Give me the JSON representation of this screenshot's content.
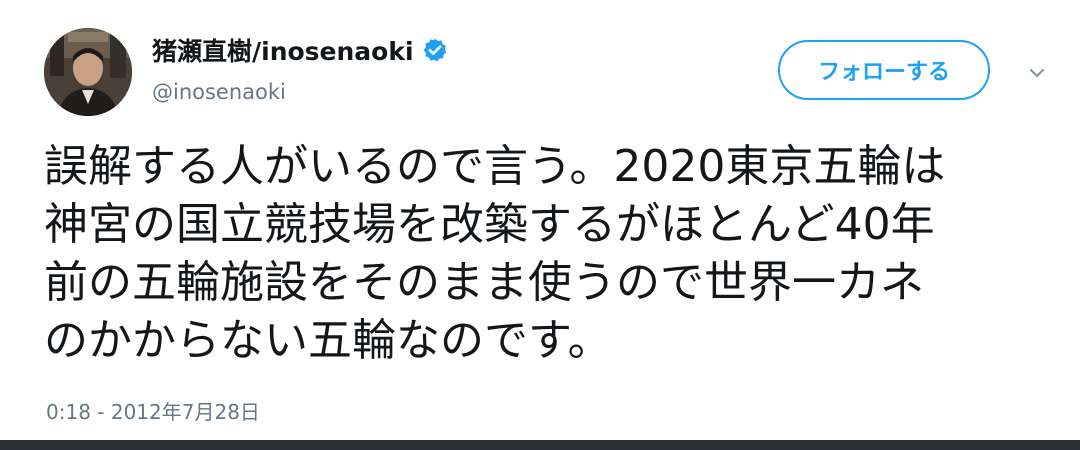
{
  "user": {
    "display_name": "猪瀬直樹/inosenaoki",
    "handle": "@inosenaoki",
    "verified_icon": "verified-badge-icon"
  },
  "actions": {
    "follow_label": "フォローする",
    "menu_icon": "chevron-down-icon"
  },
  "tweet": {
    "lines": [
      "誤解する人がいるので言う。2020東京五輪は",
      "神宮の国立競技場を改築するがほとんど40年",
      "前の五輪施設をそのまま使うので世界一カネ",
      "のかからない五輪なのです。"
    ],
    "timestamp": "0:18 - 2012年7月28日"
  },
  "colors": {
    "accent": "#1da1f2",
    "text": "#14171a",
    "secondary_text": "#657786",
    "bottom_bar": "#2b3036"
  }
}
